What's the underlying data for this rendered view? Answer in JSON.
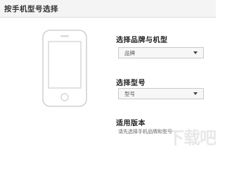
{
  "header": {
    "title": "按手机型号选择"
  },
  "brand": {
    "label": "选择品牌与机型",
    "value": "品牌"
  },
  "model": {
    "label": "选择型号",
    "value": "型号"
  },
  "version": {
    "label": "适用版本",
    "hint": "请先选择手机品牌和型号"
  },
  "icons": {
    "phone": "phone-illustration-icon",
    "dropdown": "chevron-down-icon"
  },
  "watermark": {
    "text": "下载吧"
  },
  "colors": {
    "titlebar_bg": "#f4f4f4",
    "select_bg": "#f7f7f7",
    "select_border": "#c9c9c9",
    "phone_outline": "#cfcfcf"
  }
}
